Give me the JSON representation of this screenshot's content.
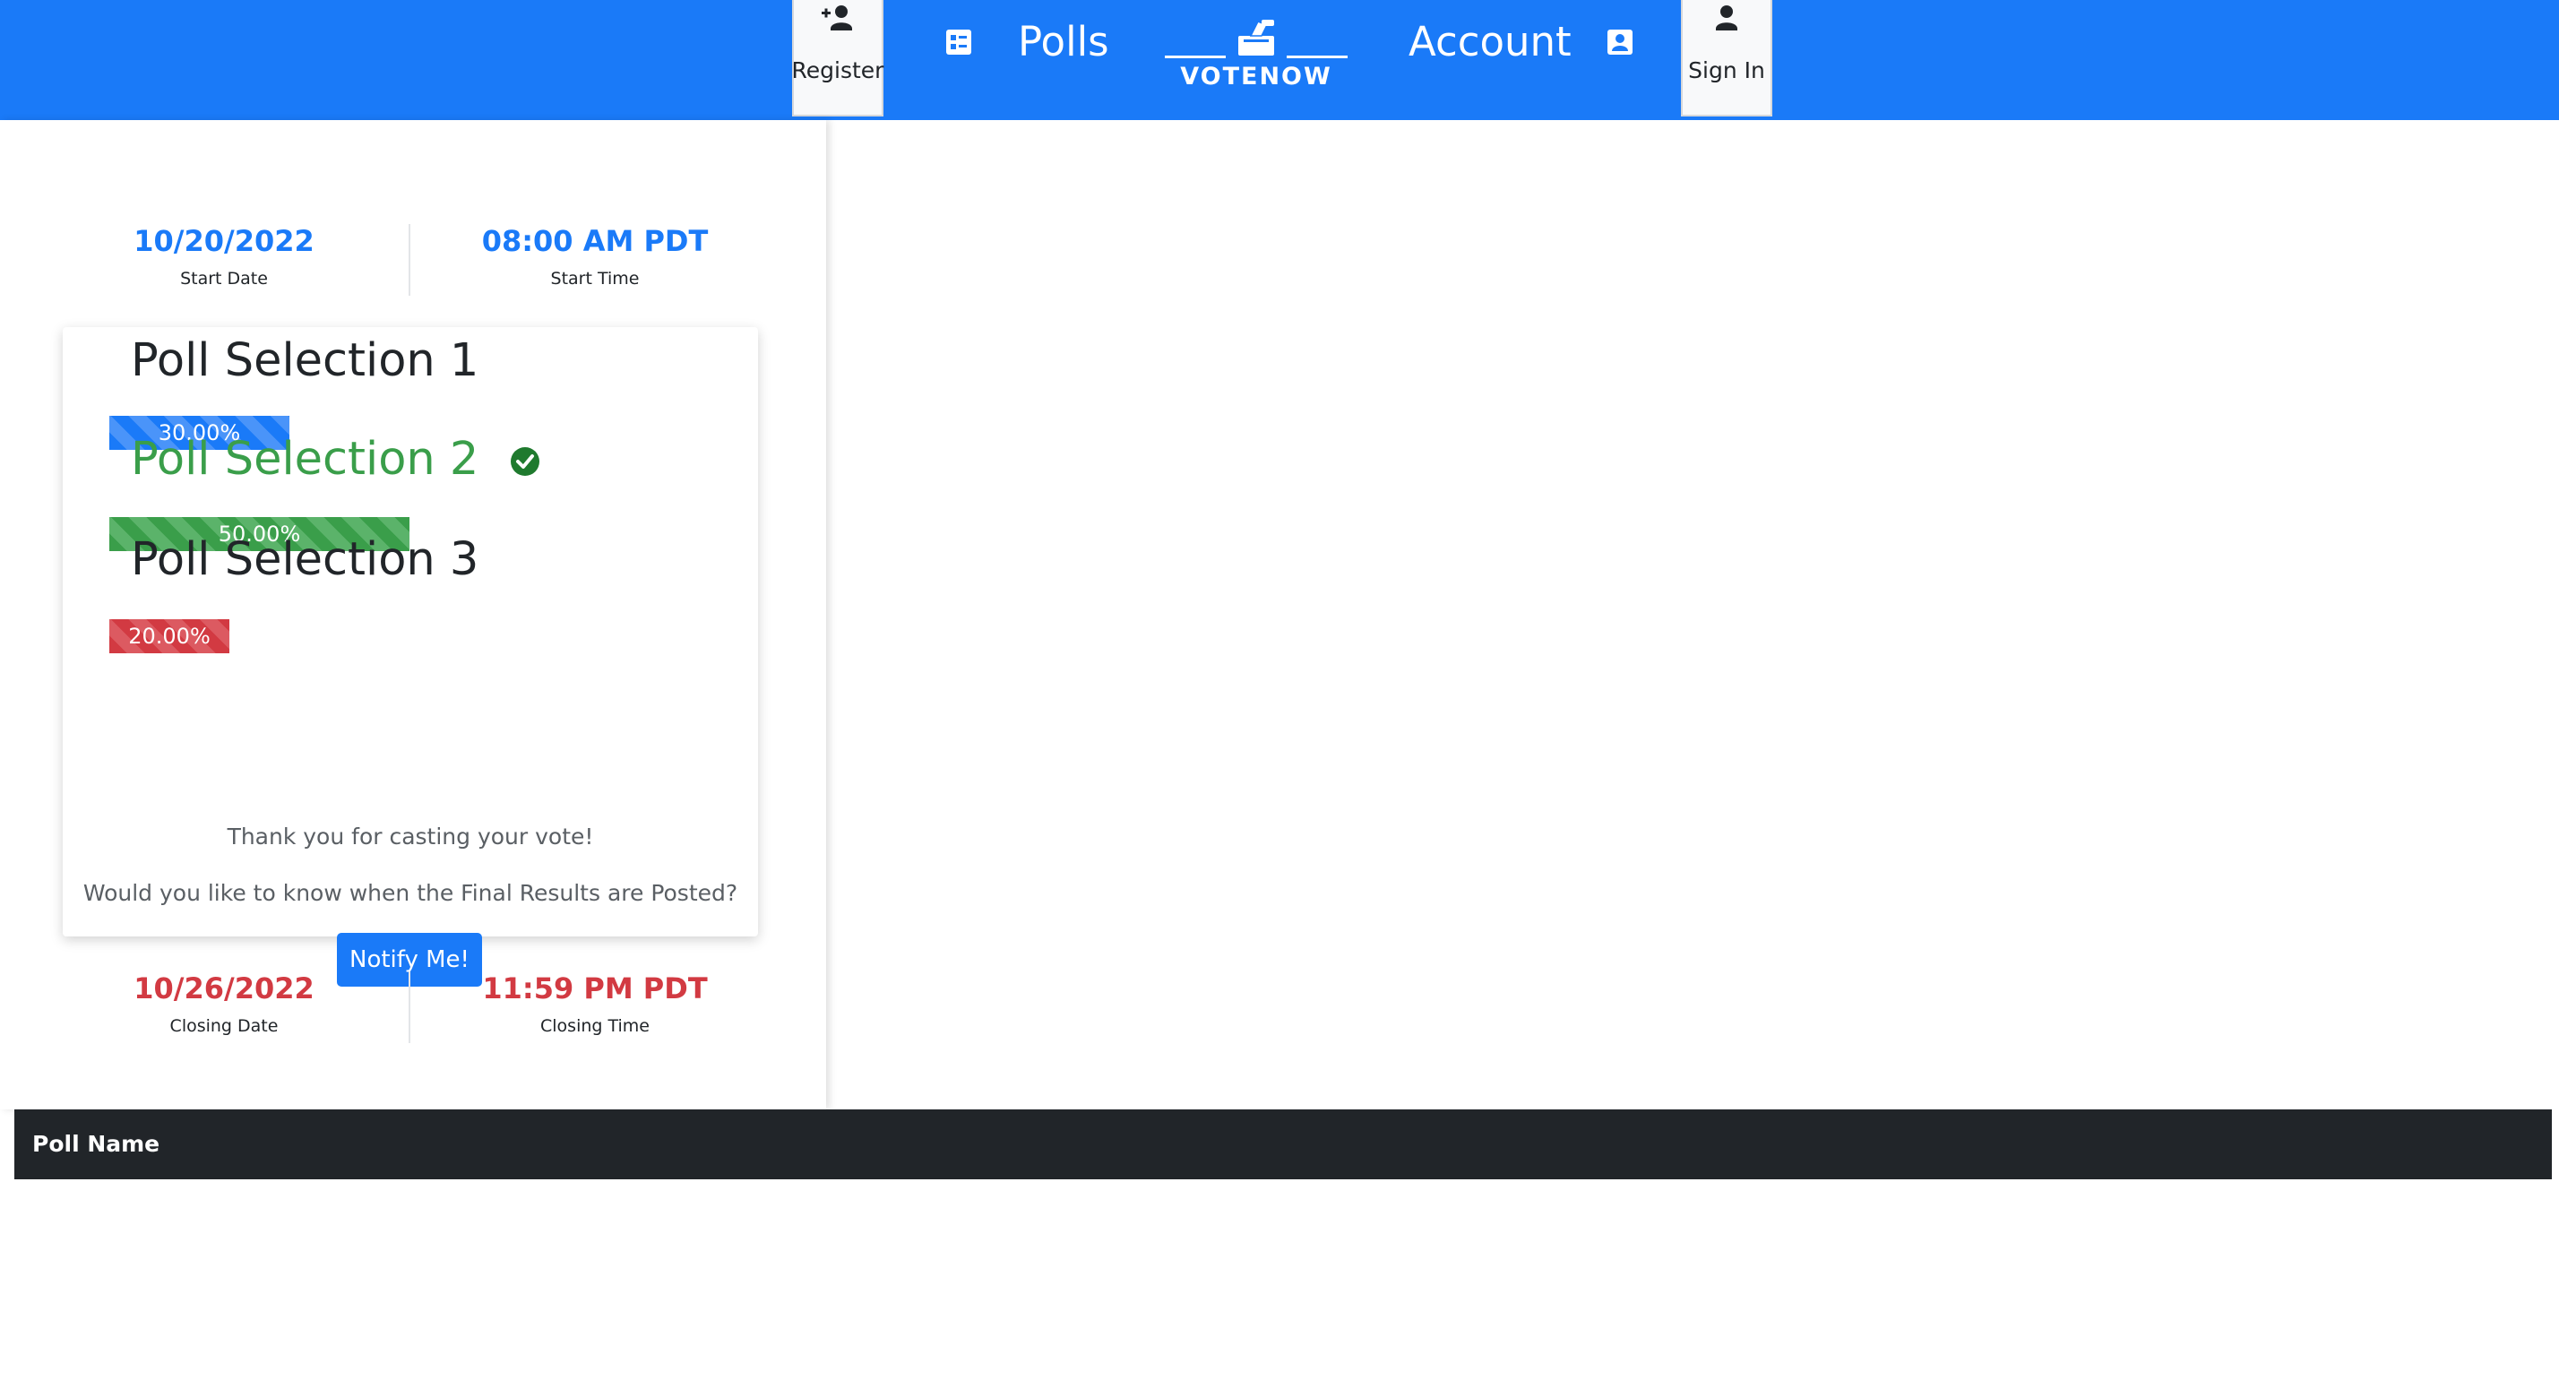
{
  "nav": {
    "register_label": "Register",
    "polls_label": "Polls",
    "account_label": "Account",
    "signin_label": "Sign In",
    "logo_text": "VOTENOW"
  },
  "poll": {
    "start_date": "10/20/2022",
    "start_date_label": "Start Date",
    "start_time": "08:00 AM PDT",
    "start_time_label": "Start Time",
    "closing_date": "10/26/2022",
    "closing_date_label": "Closing Date",
    "closing_time": "11:59 PM PDT",
    "closing_time_label": "Closing Time",
    "options": [
      {
        "title": "Poll Selection 1",
        "percent_label": "30.00%",
        "percent": 30,
        "selected": false
      },
      {
        "title": "Poll Selection 2",
        "percent_label": "50.00%",
        "percent": 50,
        "selected": true
      },
      {
        "title": "Poll Selection 3",
        "percent_label": "20.00%",
        "percent": 20,
        "selected": false
      }
    ],
    "thank_you": "Thank you for casting your vote!",
    "notify_prompt": "Would you like to know when the Final Results are Posted?",
    "notify_button": "Notify Me!"
  },
  "table": {
    "columns": [
      "Poll Name"
    ]
  },
  "colors": {
    "primary": "#1a7af8",
    "success": "#3a9e4a",
    "danger": "#d23a42",
    "dark": "#212529"
  }
}
